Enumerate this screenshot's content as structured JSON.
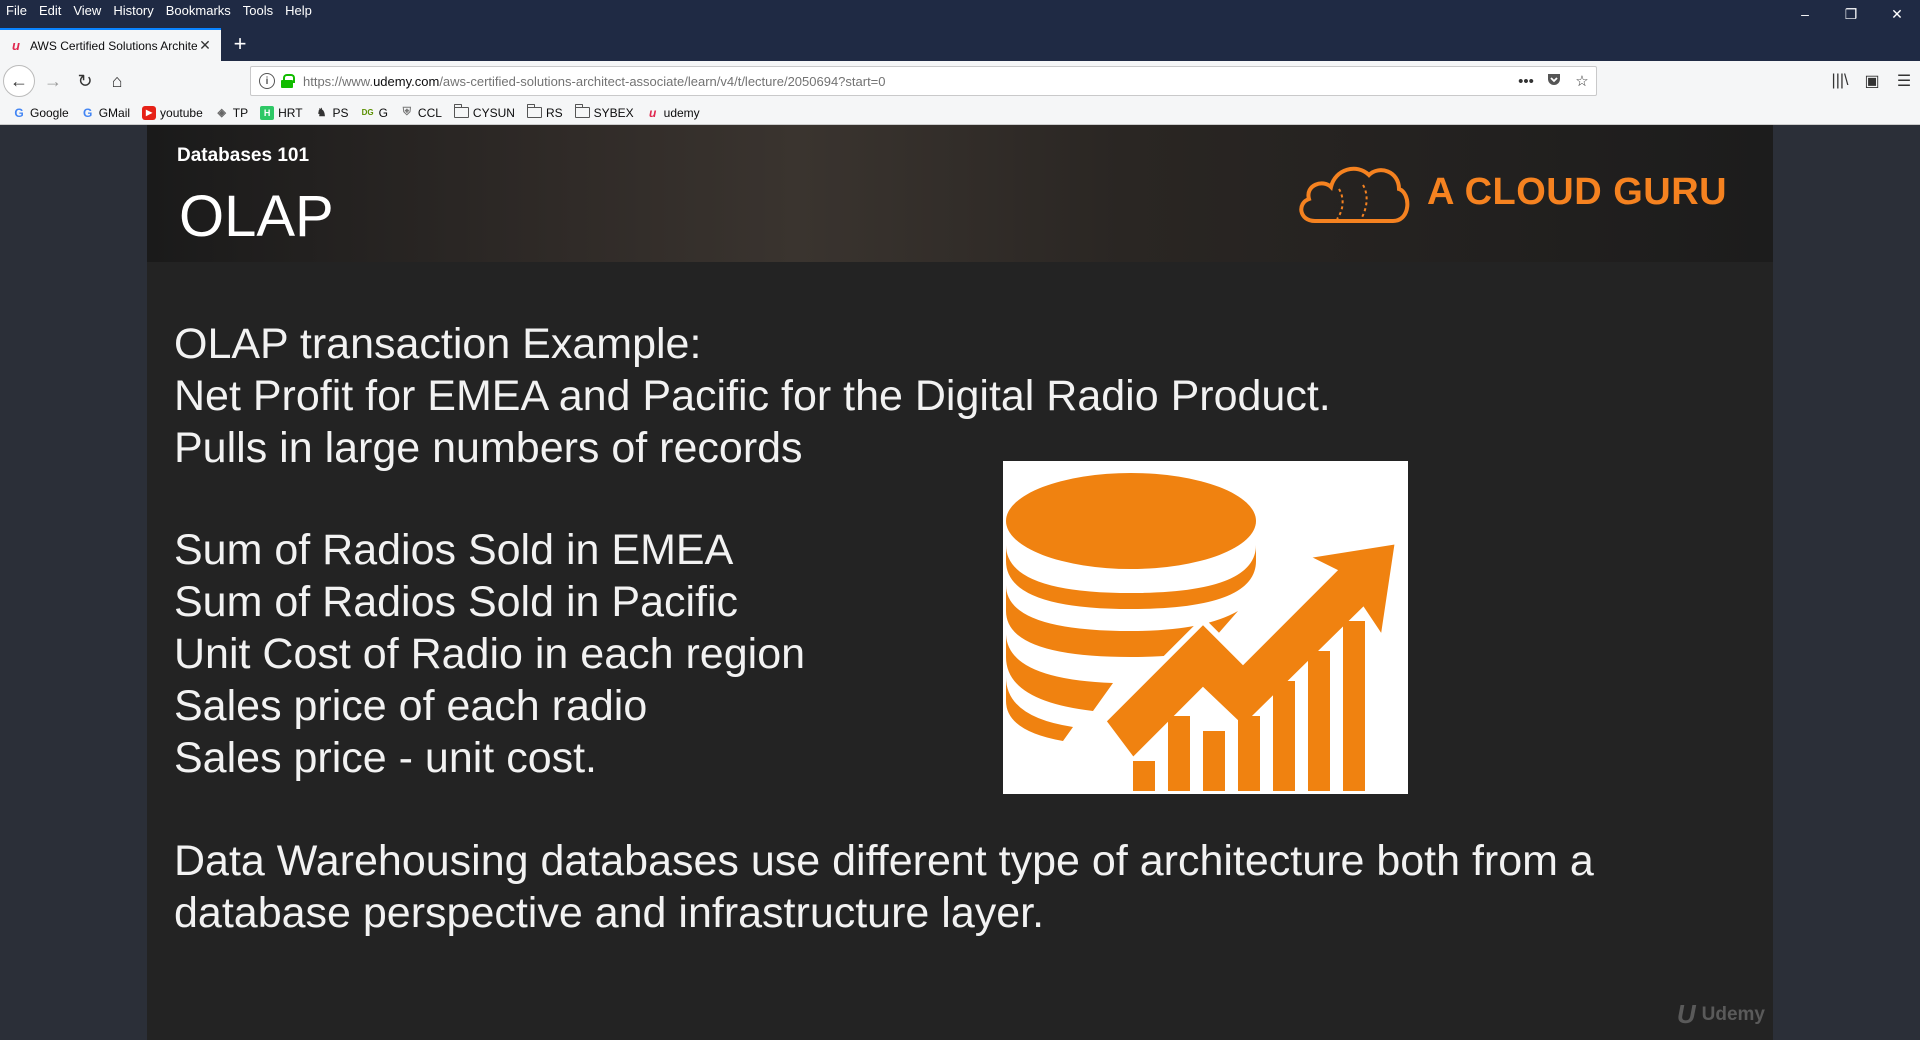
{
  "browser": {
    "menu": [
      "File",
      "Edit",
      "View",
      "History",
      "Bookmarks",
      "Tools",
      "Help"
    ],
    "window_controls": {
      "minimize": "–",
      "restore": "❐",
      "close": "✕"
    },
    "tab": {
      "title": "AWS Certified Solutions Archite",
      "favicon": "u",
      "close": "✕"
    },
    "new_tab": "+",
    "url": {
      "prefix": "https://www.",
      "domain": "udemy.com",
      "path": "/aws-certified-solutions-architect-associate/learn/v4/t/lecture/2050694?start=0"
    },
    "url_icons": {
      "more": "•••",
      "pocket": "pocket-icon",
      "star": "☆"
    },
    "nav_icons": {
      "back": "←",
      "forward": "→",
      "reload": "↻",
      "home": "⌂"
    },
    "right_icons": {
      "library": "|||\\",
      "sidebar": "▣",
      "menu": "☰"
    },
    "bookmarks": [
      {
        "label": "Google",
        "icon": "G"
      },
      {
        "label": "GMail",
        "icon": "G"
      },
      {
        "label": "youtube",
        "icon": "▶"
      },
      {
        "label": "TP",
        "icon": "◈"
      },
      {
        "label": "HRT",
        "icon": "H"
      },
      {
        "label": "PS",
        "icon": "♞"
      },
      {
        "label": "G",
        "icon": "DG"
      },
      {
        "label": "CCL",
        "icon": "⛨"
      },
      {
        "label": "CYSUN",
        "icon": ""
      },
      {
        "label": "RS",
        "icon": ""
      },
      {
        "label": "SYBEX",
        "icon": ""
      },
      {
        "label": "udemy",
        "icon": "u"
      }
    ]
  },
  "slide": {
    "subtitle": "Databases 101",
    "title": "OLAP",
    "brand": "A CLOUD GURU",
    "block1": [
      "OLAP transaction Example:",
      "Net Profit for EMEA and Pacific for the Digital Radio Product.",
      "Pulls in large numbers of records"
    ],
    "block2": [
      "Sum of Radios Sold in EMEA",
      "Sum of Radios Sold in Pacific",
      "Unit Cost of Radio in each region",
      "Sales price of each radio",
      "Sales price - unit cost."
    ],
    "block3": [
      "Data Warehousing databases use different type of architecture both from a",
      "database perspective and infrastructure layer."
    ],
    "watermark": "Udemy",
    "accent_color": "#f58220"
  }
}
